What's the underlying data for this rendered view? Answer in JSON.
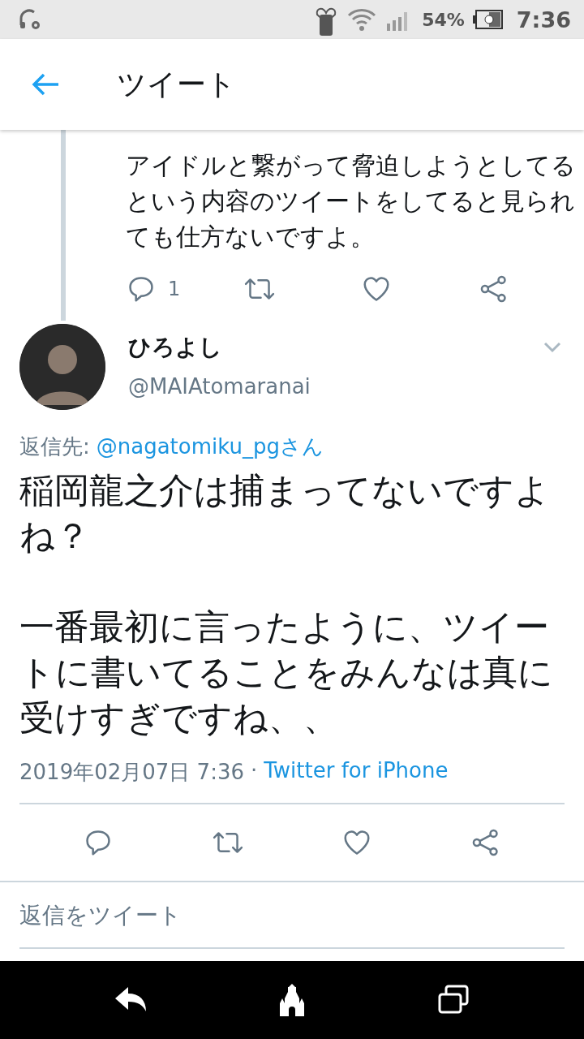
{
  "status_bar": {
    "battery": "54%",
    "time": "7:36"
  },
  "header": {
    "title": "ツイート"
  },
  "previous_tweet": {
    "text": "アイドルと繋がって脅迫しようとしてるという内容のツイートをしてると見られても仕方ないですよ。",
    "reply_count": "1"
  },
  "tweet": {
    "name": "ひろよし",
    "handle": "@MAIAtomaranai",
    "reply_to_label": "返信先:",
    "reply_to": "@nagatomiku_pgさん",
    "paragraphs": [
      "稲岡龍之介は捕まってないですよね？",
      "一番最初に言ったように、ツイートに書いてることをみんなは真に受けすぎですね、、"
    ],
    "timestamp": "2019年02月07日 7:36",
    "separator": "·",
    "source": "Twitter for iPhone"
  },
  "reply_box": {
    "placeholder": "返信をツイート"
  }
}
